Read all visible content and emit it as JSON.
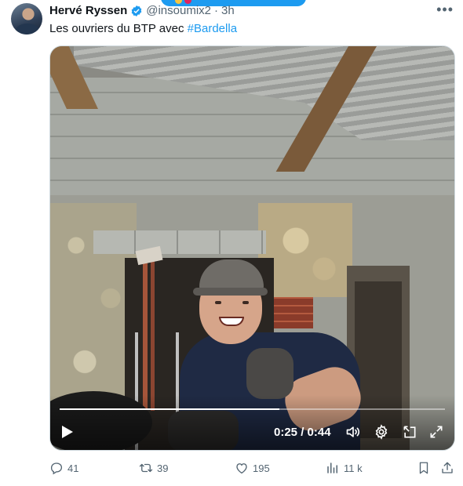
{
  "author": {
    "name": "Hervé Ryssen",
    "handle": "@insoumix2",
    "separator": "·",
    "time": "3h",
    "verified": true
  },
  "tweet": {
    "text": "Les ouvriers du BTP avec ",
    "hashtag": "#Bardella"
  },
  "video": {
    "current_time": "0:25",
    "duration": "0:44",
    "time_display": "0:25 / 0:44",
    "progress_fraction": 0.57
  },
  "actions": {
    "replies": "41",
    "reposts": "39",
    "likes": "195",
    "views": "11 k"
  },
  "colors": {
    "accent": "#1d9bf0",
    "muted_text": "#536471",
    "text": "#0f1419"
  },
  "icons": {
    "more": "more-icon",
    "verified": "verified-badge-icon",
    "play": "play-icon",
    "volume": "volume-icon",
    "settings": "gear-icon",
    "pip": "picture-in-picture-icon",
    "fullscreen": "fullscreen-icon",
    "reply": "reply-icon",
    "repost": "repost-icon",
    "like": "heart-icon",
    "views": "views-icon",
    "bookmark": "bookmark-icon",
    "share": "share-icon"
  }
}
